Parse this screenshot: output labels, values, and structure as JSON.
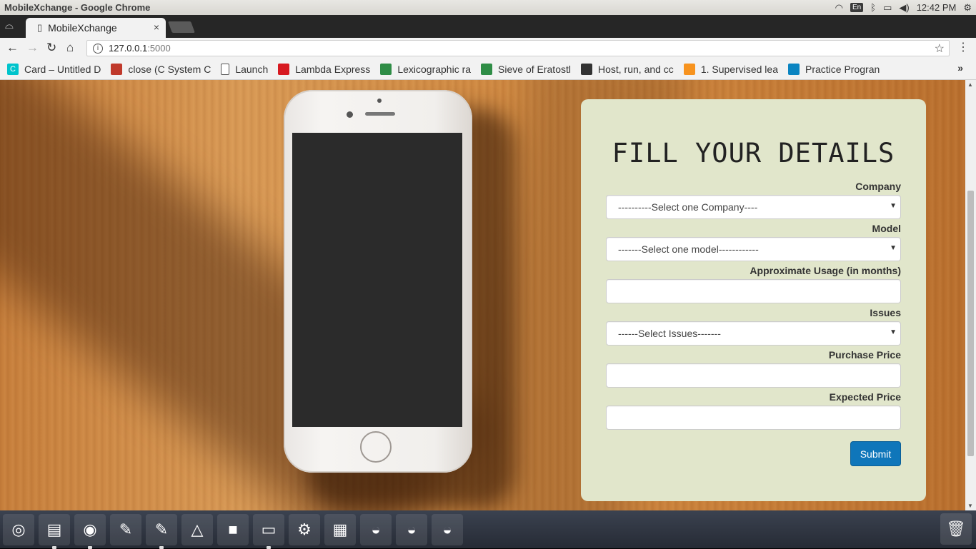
{
  "system_panel": {
    "window_title": "MobileXchange - Google Chrome",
    "keyboard_layout": "En",
    "clock": "12:42 PM"
  },
  "browser": {
    "tab": {
      "title": "MobileXchange",
      "close_symbol": "×"
    },
    "address_bar": {
      "host": "127.0.0.1",
      "port": ":5000"
    },
    "bookmarks": [
      {
        "label": "Card – Untitled D",
        "icon": "canva-icon",
        "color": "#00c4cc",
        "glyph": "C"
      },
      {
        "label": "close (C System C",
        "icon": "bug-icon",
        "color": "#c0392b",
        "glyph": ""
      },
      {
        "label": "Launch",
        "icon": "page-icon",
        "color": "#ffffff",
        "glyph": ""
      },
      {
        "label": "Lambda Express",
        "icon": "lambda-icon",
        "color": "#d71920",
        "glyph": ""
      },
      {
        "label": "Lexicographic ra",
        "icon": "geeks-icon",
        "color": "#2f8d46",
        "glyph": ""
      },
      {
        "label": "Sieve of Eratostl",
        "icon": "geeks-icon",
        "color": "#2f8d46",
        "glyph": ""
      },
      {
        "label": "Host, run, and cc",
        "icon": "host-icon",
        "color": "#333333",
        "glyph": ""
      },
      {
        "label": "1. Supervised lea",
        "icon": "sklearn-icon",
        "color": "#f7931e",
        "glyph": ""
      },
      {
        "label": "Practice Progran",
        "icon": "practice-icon",
        "color": "#0a84c1",
        "glyph": ""
      }
    ],
    "bookmarks_more": "»"
  },
  "form": {
    "heading": "FILL YOUR DETAILS",
    "company_label": "Company",
    "company_selected": "----------Select one Company----",
    "model_label": "Model",
    "model_selected": "-------Select one model------------",
    "usage_label": "Approximate Usage (in months)",
    "usage_value": "",
    "issues_label": "Issues",
    "issues_selected": "------Select Issues-------",
    "purchase_label": "Purchase Price",
    "purchase_value": "",
    "expected_label": "Expected Price",
    "expected_value": "",
    "submit_label": "Submit"
  },
  "colors": {
    "card_bg": "#e1e6cb",
    "submit_bg": "#0f76ba"
  },
  "dock": {
    "items": [
      "ubuntu-logo-icon",
      "files-icon",
      "chrome-icon",
      "text-editor-icon",
      "text-editor-icon",
      "android-studio-icon",
      "intellij-icon",
      "terminal-icon",
      "settings-icon",
      "workspace-icon",
      "drive-icon",
      "drive-icon",
      "drive-icon"
    ],
    "trash": "trash-icon"
  }
}
